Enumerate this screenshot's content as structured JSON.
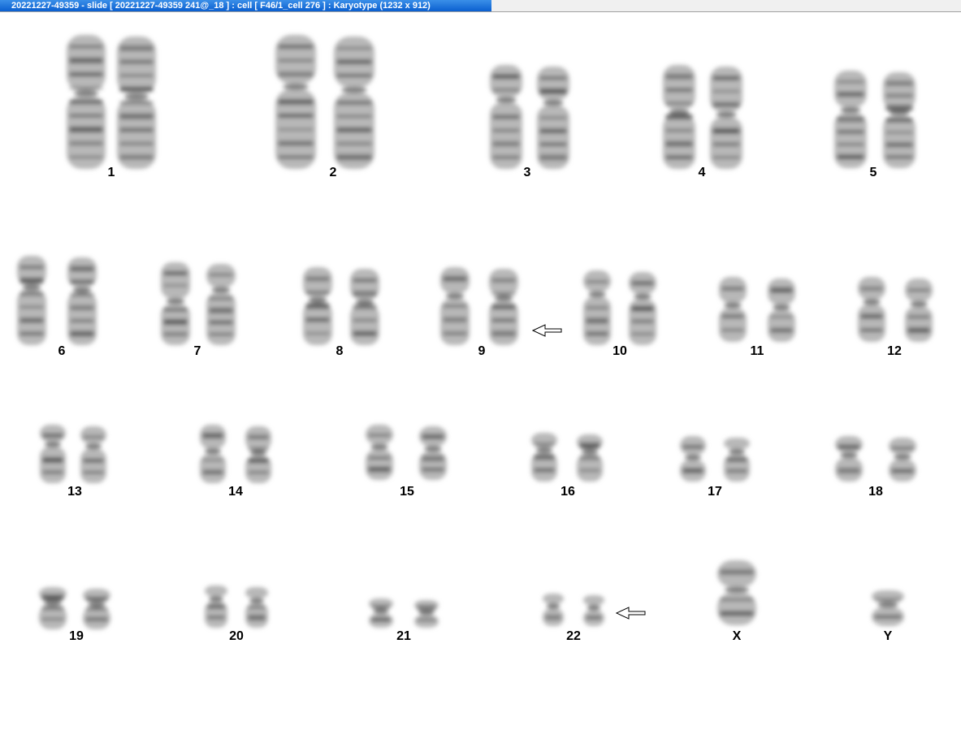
{
  "window": {
    "title": "20221227-49359 - slide [ 20221227-49359 241@_18 ] : cell [ F46/1_cell 276 ] : Karyotype  (1232 x 912)"
  },
  "chromosomes": [
    {
      "label": "1"
    },
    {
      "label": "2"
    },
    {
      "label": "3"
    },
    {
      "label": "4"
    },
    {
      "label": "5"
    },
    {
      "label": "6"
    },
    {
      "label": "7"
    },
    {
      "label": "8"
    },
    {
      "label": "9"
    },
    {
      "label": "10"
    },
    {
      "label": "11"
    },
    {
      "label": "12"
    },
    {
      "label": "13"
    },
    {
      "label": "14"
    },
    {
      "label": "15"
    },
    {
      "label": "16"
    },
    {
      "label": "17"
    },
    {
      "label": "18"
    },
    {
      "label": "19"
    },
    {
      "label": "20"
    },
    {
      "label": "21"
    },
    {
      "label": "22"
    },
    {
      "label": "X"
    },
    {
      "label": "Y"
    }
  ],
  "colors": {
    "title_bg": "#0a5fd0",
    "title_text": "#ffffff",
    "chromatin_dark": "#4a4a4a",
    "chromatin_light": "#b8b8b8"
  }
}
